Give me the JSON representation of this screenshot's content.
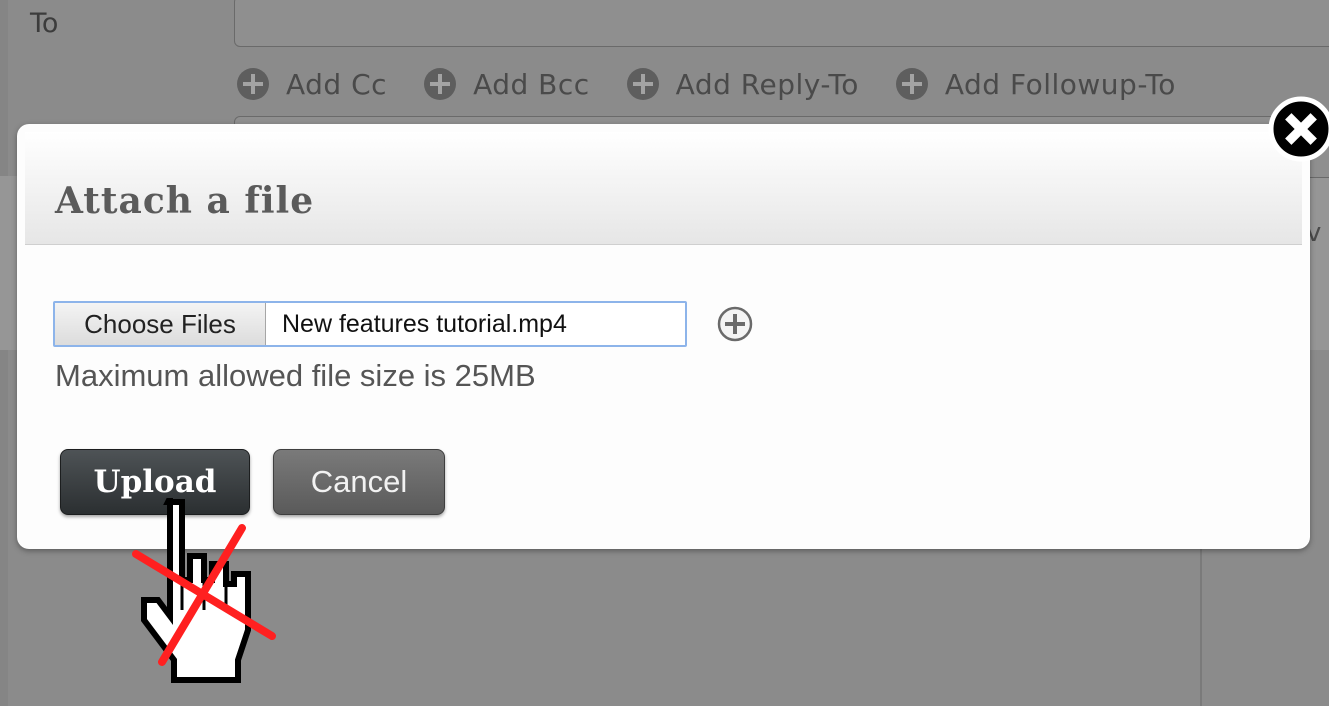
{
  "compose": {
    "to_label": "To",
    "add_links": [
      {
        "label": "Add Cc"
      },
      {
        "label": "Add Bcc"
      },
      {
        "label": "Add Reply-To"
      },
      {
        "label": "Add Followup-To"
      }
    ],
    "right_glyph": "v"
  },
  "modal": {
    "title": "Attach a file",
    "choose_files_label": "Choose Files",
    "file_name": "New features tutorial.mp4",
    "size_note": "Maximum allowed file size is 25MB",
    "upload_label": "Upload",
    "cancel_label": "Cancel",
    "add_file_icon": "plus-circle-icon",
    "close_icon": "close-x-icon"
  },
  "overlay": {
    "cursor_icon": "hand-pointer-icon",
    "cross_icon": "red-x-icon",
    "colors": {
      "cross": "#ff2020",
      "upload_bg": "#2f3336",
      "focus_border": "#8db4ea"
    }
  }
}
